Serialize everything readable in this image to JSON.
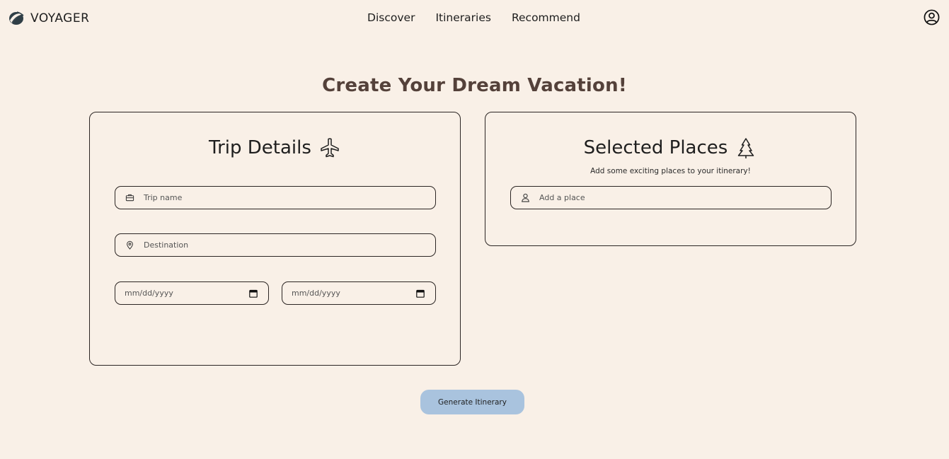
{
  "brand": {
    "name": "VOYAGER",
    "logo_icon": "globe-leaf-icon"
  },
  "nav": {
    "links": [
      {
        "label": "Discover"
      },
      {
        "label": "Itineraries"
      },
      {
        "label": "Recommend"
      }
    ],
    "profile_icon": "user-circle-icon"
  },
  "page": {
    "title": "Create Your Dream Vacation!"
  },
  "trip_details": {
    "title": "Trip Details",
    "title_icon": "airplane-icon",
    "trip_name": {
      "placeholder": "Trip name",
      "value": "",
      "icon": "briefcase-icon"
    },
    "destination": {
      "placeholder": "Destination",
      "value": "",
      "icon": "map-pin-icon"
    },
    "start_date": {
      "placeholder": "mm/dd/yyyy",
      "value": "",
      "icon": "calendar-icon"
    },
    "end_date": {
      "placeholder": "mm/dd/yyyy",
      "value": "",
      "icon": "calendar-icon"
    }
  },
  "selected_places": {
    "title": "Selected Places",
    "title_icon": "tree-icon",
    "subtitle": "Add some exciting places to your itinerary!",
    "add_place": {
      "placeholder": "Add a place",
      "value": "",
      "icon": "person-icon"
    }
  },
  "actions": {
    "generate_label": "Generate Itinerary",
    "generate_color": "#a9c3de"
  },
  "colors": {
    "background": "#f9f0e7",
    "title": "#54413a",
    "border": "#2b2523"
  }
}
